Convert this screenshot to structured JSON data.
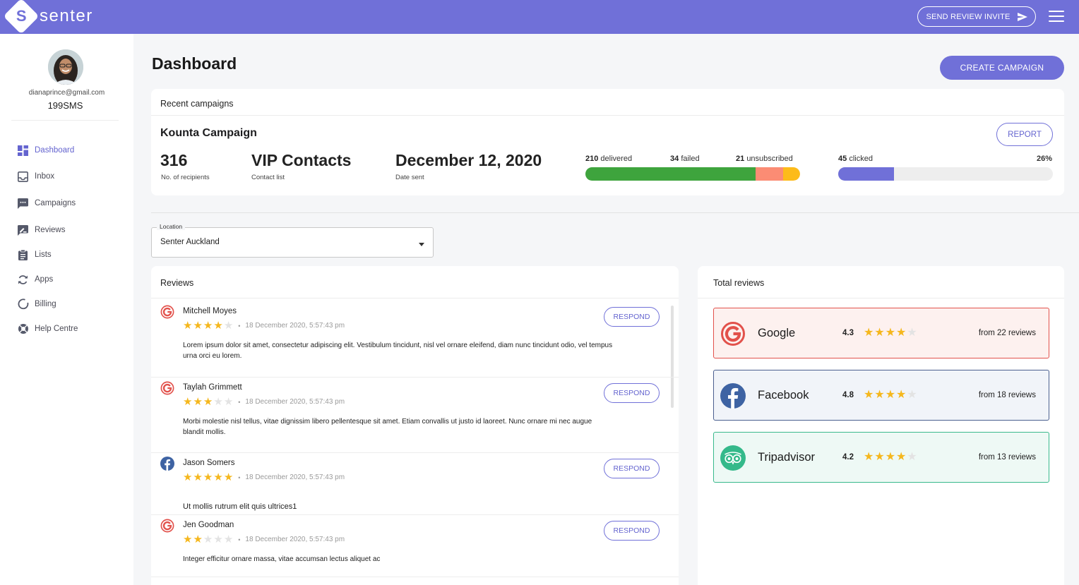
{
  "header": {
    "logo_letter": "S",
    "logo_text": "senter",
    "invite_label": "SEND REVIEW INVITE",
    "brand_color": "#7070d8"
  },
  "user": {
    "email": "dianaprince@gmail.com",
    "plan": "199SMS"
  },
  "sidebar": {
    "items": [
      {
        "label": "Dashboard",
        "icon": "dashboard-icon",
        "active": true
      },
      {
        "label": "Inbox",
        "icon": "inbox-icon"
      },
      {
        "label": "Campaigns",
        "icon": "chat-icon"
      },
      {
        "label": "Reviews",
        "icon": "rate-review-icon"
      },
      {
        "label": "Lists",
        "icon": "clipboard-list-icon"
      },
      {
        "label": "Apps",
        "icon": "sync-icon"
      },
      {
        "label": "Billing",
        "icon": "circle-icon"
      },
      {
        "label": "Help Centre",
        "icon": "lifebuoy-icon"
      }
    ]
  },
  "page": {
    "title": "Dashboard",
    "create_label": "CREATE CAMPAIGN"
  },
  "campaigns": {
    "header": "Recent campaigns",
    "name": "Kounta Campaign",
    "report_label": "REPORT",
    "recipients": {
      "value": "316",
      "label": "No. of recipients"
    },
    "contact_list": {
      "value": "VIP Contacts",
      "label": "Contact list"
    },
    "date_sent": {
      "value": "December 12, 2020",
      "label": "Date sent"
    },
    "delivery": {
      "delivered": {
        "count": "210",
        "label": "delivered"
      },
      "failed": {
        "count": "34",
        "label": "failed"
      },
      "unsubscribed": {
        "count": "21",
        "label": "unsubscribed"
      },
      "colors": {
        "delivered": "#3ea43d",
        "failed": "#fb8c74",
        "unsubscribed": "#fdbb1a"
      }
    },
    "clicks": {
      "count": "45",
      "label": "clicked",
      "percent_text": "26%",
      "percent": 26,
      "color": "#7070d8"
    }
  },
  "location": {
    "label": "Location",
    "value": "Senter Auckland"
  },
  "reviews": {
    "header": "Reviews",
    "respond_label": "RESPOND",
    "items": [
      {
        "name": "Mitchell Moyes",
        "source": "google",
        "rating": 4,
        "date": "18 December 2020, 5:57:43 pm",
        "text": "Lorem ipsum dolor sit amet, consectetur adipiscing elit. Vestibulum tincidunt, nisl vel ornare eleifend, diam nunc tincidunt odio, vel tempus urna orci eu lorem."
      },
      {
        "name": "Taylah Grimmett",
        "source": "google",
        "rating": 3,
        "date": "18 December 2020, 5:57:43 pm",
        "text": "Morbi molestie nisl tellus, vitae dignissim libero pellentesque sit amet. Etiam convallis ut justo id laoreet. Nunc ornare mi nec augue blandit mollis."
      },
      {
        "name": "Jason Somers",
        "source": "facebook",
        "rating": 5,
        "date": "18 December 2020, 5:57:43 pm",
        "text": "Ut mollis rutrum elit quis ultrices1"
      },
      {
        "name": "Jen Goodman",
        "source": "google",
        "rating": 2,
        "date": "18 December 2020, 5:57:43 pm",
        "text": "Integer efficitur ornare massa, vitae accumsan lectus aliquet ac"
      }
    ]
  },
  "totals": {
    "header": "Total reviews",
    "platforms": [
      {
        "name": "Google",
        "rating": "4.3",
        "stars": 4,
        "count": "from 22 reviews",
        "icon": "google-icon",
        "border": "#e2514b",
        "bg": "#fdf1ef"
      },
      {
        "name": "Facebook",
        "rating": "4.8",
        "stars": 4,
        "count": "from 18 reviews",
        "icon": "facebook-icon",
        "border": "#4a5f8f",
        "bg": "#f1f4f9"
      },
      {
        "name": "Tripadvisor",
        "rating": "4.2",
        "stars": 4,
        "count": "from 13 reviews",
        "icon": "tripadvisor-icon",
        "border": "#39b98c",
        "bg": "#eef9f5"
      }
    ]
  }
}
